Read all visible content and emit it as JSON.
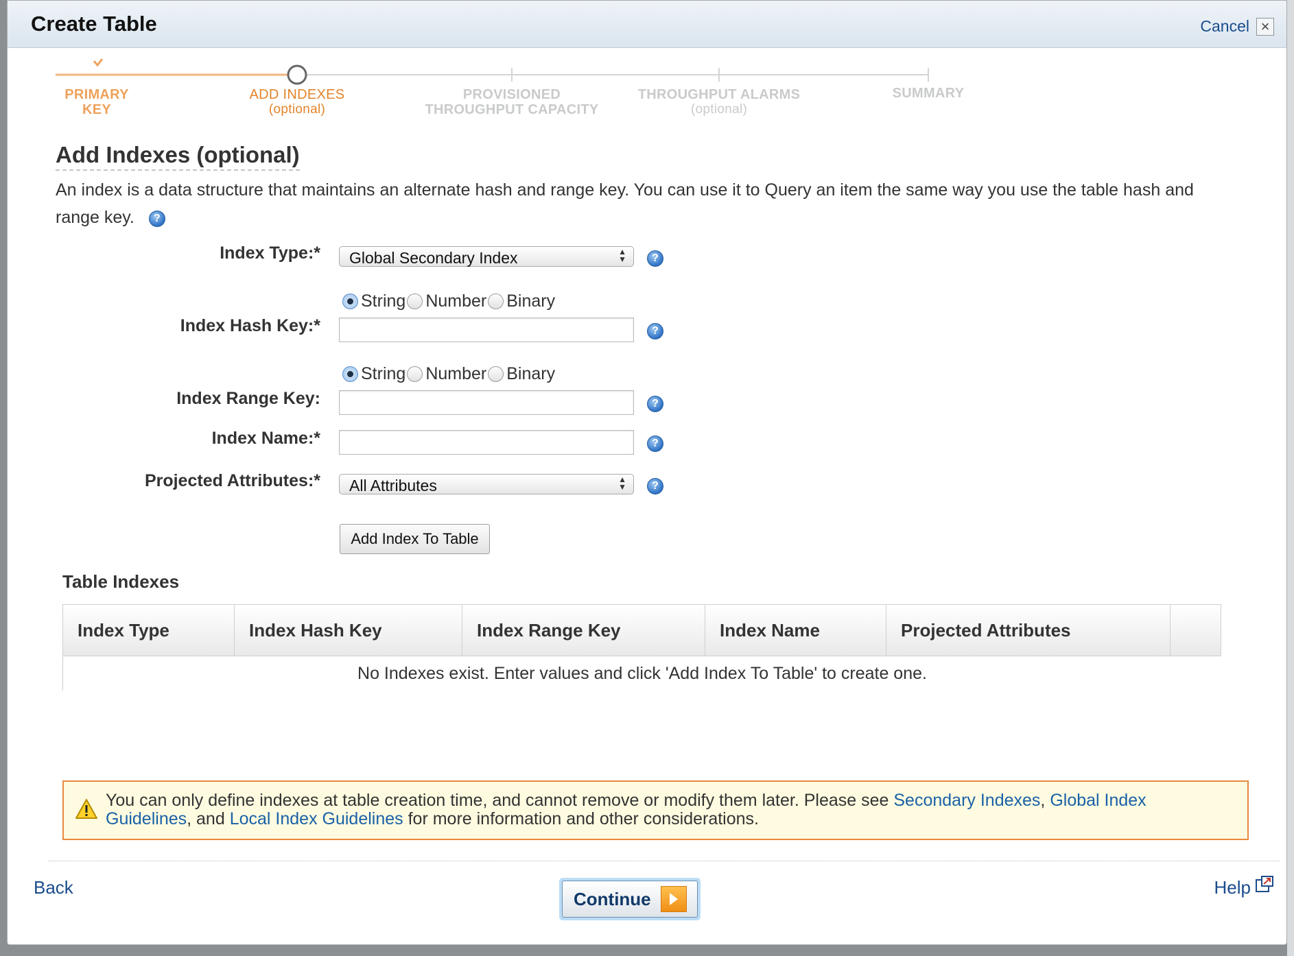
{
  "dialog": {
    "title": "Create Table",
    "cancel_label": "Cancel"
  },
  "wizard": {
    "steps": [
      {
        "label": "PRIMARY KEY",
        "sub": "",
        "state": "done"
      },
      {
        "label": "ADD INDEXES",
        "sub": "(optional)",
        "state": "current"
      },
      {
        "label": "PROVISIONED",
        "sub": "THROUGHPUT CAPACITY",
        "state": "future"
      },
      {
        "label": "THROUGHPUT ALARMS",
        "sub": "(optional)",
        "state": "future"
      },
      {
        "label": "SUMMARY",
        "sub": "",
        "state": "future"
      }
    ]
  },
  "main": {
    "heading": "Add Indexes (optional)",
    "description": "An index is a data structure that maintains an alternate hash and range key. You can use it to Query an item the same way you use the table hash and range key."
  },
  "form": {
    "index_type": {
      "label": "Index Type:*",
      "value": "Global Secondary Index"
    },
    "key_types": [
      "String",
      "Number",
      "Binary"
    ],
    "hash_key": {
      "label": "Index Hash Key:*",
      "selected_type": "String",
      "value": ""
    },
    "range_key": {
      "label": "Index Range Key:",
      "selected_type": "String",
      "value": ""
    },
    "index_name": {
      "label": "Index Name:*",
      "value": ""
    },
    "projected_attributes": {
      "label": "Projected Attributes:*",
      "value": "All Attributes"
    },
    "add_button": "Add Index To Table"
  },
  "table": {
    "title": "Table Indexes",
    "columns": [
      "Index Type",
      "Index Hash Key",
      "Index Range Key",
      "Index Name",
      "Projected Attributes",
      ""
    ],
    "empty_message": "No Indexes exist. Enter values and click 'Add Index To Table' to create one."
  },
  "notice": {
    "text_1": "You can only define indexes at table creation time, and cannot remove or modify them later. Please see ",
    "link_1": "Secondary Indexes",
    "sep_1": ", ",
    "link_2": "Global Index Guidelines",
    "sep_2": ", and ",
    "link_3": "Local Index Guidelines",
    "text_2": " for more information and other considerations."
  },
  "footer": {
    "back": "Back",
    "continue": "Continue",
    "help": "Help"
  },
  "colors": {
    "accent_orange": "#e3842a",
    "link_blue": "#1a61a7",
    "notice_border": "#e8893e"
  }
}
